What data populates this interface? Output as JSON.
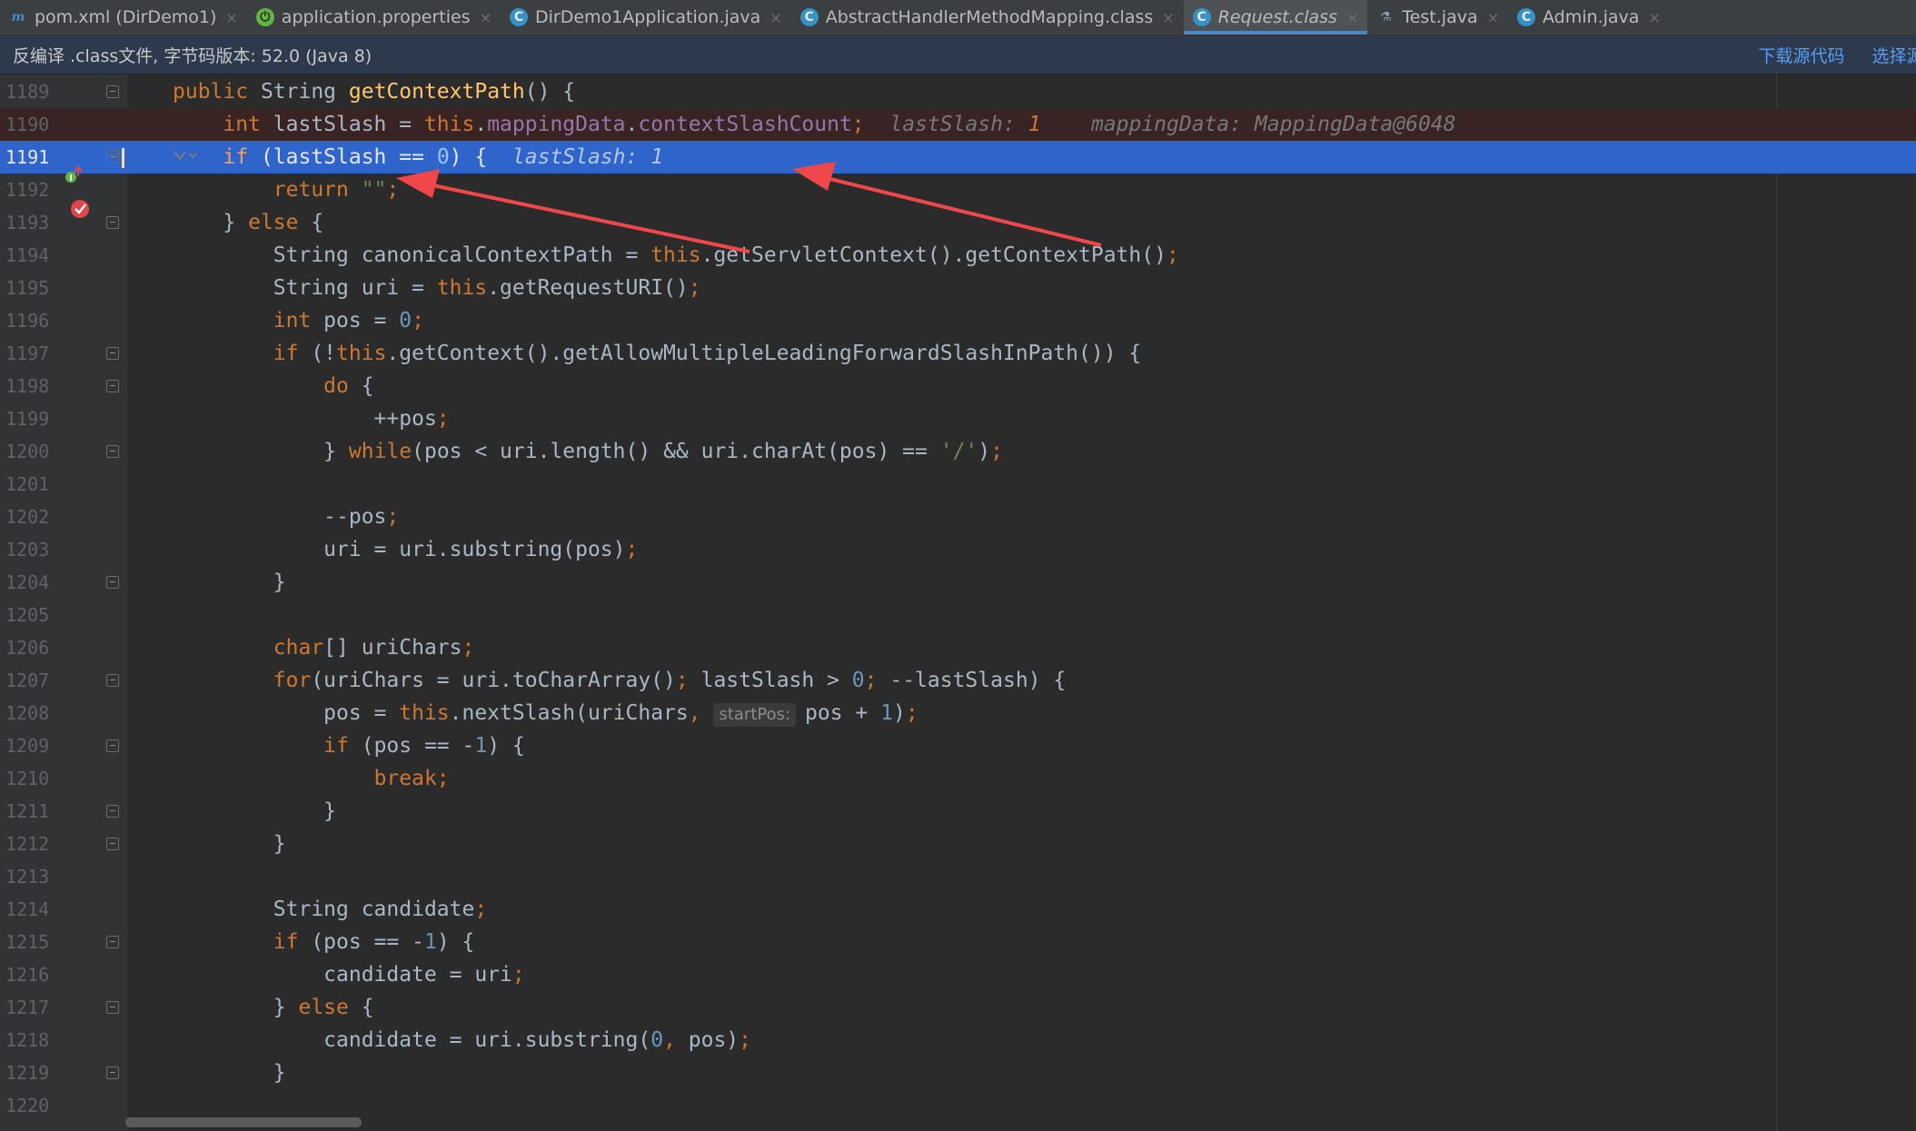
{
  "tabs": [
    {
      "label": "pom.xml (DirDemo1)",
      "icon": "maven-icon",
      "active": false
    },
    {
      "label": "application.properties",
      "icon": "spring-icon",
      "active": false
    },
    {
      "label": "DirDemo1Application.java",
      "icon": "spring-class-icon",
      "active": false
    },
    {
      "label": "AbstractHandlerMethodMapping.class",
      "icon": "class-icon",
      "active": false
    },
    {
      "label": "Request.class",
      "icon": "class-icon",
      "active": true
    },
    {
      "label": "Test.java",
      "icon": "test-icon",
      "active": false
    },
    {
      "label": "Admin.java",
      "icon": "class-icon",
      "active": false
    }
  ],
  "tab_close_glyph": "×",
  "banner": {
    "text": "反编译 .class文件, 字节码版本: 52.0 (Java 8)",
    "download_source": "下载源代码",
    "choose_source": "选择源 ("
  },
  "colors": {
    "accent": "#2f65ca",
    "breakpoint": "#e0474c",
    "arrow": "#f0474a"
  },
  "editor": {
    "current_line": 1191,
    "breakpoint_line": 1190,
    "param_hint_label": "startPos:",
    "lines": [
      {
        "num": "1189",
        "tokens": [
          [
            "t-kw",
            "public "
          ],
          [
            "",
            "String "
          ],
          [
            "t-fn",
            "getContextPath"
          ],
          [
            "",
            "() {"
          ]
        ]
      },
      {
        "num": "1190",
        "tokens": [
          [
            "",
            "    "
          ],
          [
            "t-kw",
            "int "
          ],
          [
            "",
            "lastSlash = "
          ],
          [
            "t-kw",
            "this"
          ],
          [
            "",
            "."
          ],
          [
            "t-fld",
            "mappingData"
          ],
          [
            "",
            "."
          ],
          [
            "t-fld",
            "contextSlashCount"
          ],
          [
            "t-kw",
            ";"
          ],
          [
            "",
            "  "
          ],
          [
            "t-hint",
            "lastSlash: "
          ],
          [
            "t-hintval",
            "1"
          ],
          [
            "",
            "    "
          ],
          [
            "t-hint",
            "mappingData: MappingData@6048"
          ]
        ]
      },
      {
        "num": "1191",
        "tokens": [
          [
            "",
            "    "
          ],
          [
            "t-kw",
            "if "
          ],
          [
            "",
            "(lastSlash == "
          ],
          [
            "t-num",
            "0"
          ],
          [
            "",
            ") {  "
          ],
          [
            "t-hint",
            "lastSlash: 1"
          ]
        ]
      },
      {
        "num": "1192",
        "tokens": [
          [
            "",
            "        "
          ],
          [
            "t-kw",
            "return "
          ],
          [
            "t-str",
            "\"\""
          ],
          [
            "t-kw",
            ";"
          ]
        ]
      },
      {
        "num": "1193",
        "tokens": [
          [
            "",
            "    } "
          ],
          [
            "t-kw",
            "else "
          ],
          [
            "",
            "{"
          ]
        ]
      },
      {
        "num": "1194",
        "tokens": [
          [
            "",
            "        String canonicalContextPath = "
          ],
          [
            "t-kw",
            "this"
          ],
          [
            "",
            ".getServletContext().getContextPath()"
          ],
          [
            "t-kw",
            ";"
          ]
        ]
      },
      {
        "num": "1195",
        "tokens": [
          [
            "",
            "        String uri = "
          ],
          [
            "t-kw",
            "this"
          ],
          [
            "",
            ".getRequestURI()"
          ],
          [
            "t-kw",
            ";"
          ]
        ]
      },
      {
        "num": "1196",
        "tokens": [
          [
            "",
            "        "
          ],
          [
            "t-kw",
            "int "
          ],
          [
            "",
            "pos = "
          ],
          [
            "t-num",
            "0"
          ],
          [
            "t-kw",
            ";"
          ]
        ]
      },
      {
        "num": "1197",
        "tokens": [
          [
            "",
            "        "
          ],
          [
            "t-kw",
            "if "
          ],
          [
            "",
            "(!"
          ],
          [
            "t-kw",
            "this"
          ],
          [
            "",
            ".getContext().getAllowMultipleLeadingForwardSlashInPath()) {"
          ]
        ]
      },
      {
        "num": "1198",
        "tokens": [
          [
            "",
            "            "
          ],
          [
            "t-kw",
            "do "
          ],
          [
            "",
            "{"
          ]
        ]
      },
      {
        "num": "1199",
        "tokens": [
          [
            "",
            "                ++pos"
          ],
          [
            "t-kw",
            ";"
          ]
        ]
      },
      {
        "num": "1200",
        "tokens": [
          [
            "",
            "            } "
          ],
          [
            "t-kw",
            "while"
          ],
          [
            "",
            "(pos < uri.length() && uri.charAt(pos) == "
          ],
          [
            "t-str",
            "'/'"
          ],
          [
            "",
            ")"
          ],
          [
            "t-kw",
            ";"
          ]
        ]
      },
      {
        "num": "1201",
        "tokens": []
      },
      {
        "num": "1202",
        "tokens": [
          [
            "",
            "            --pos"
          ],
          [
            "t-kw",
            ";"
          ]
        ]
      },
      {
        "num": "1203",
        "tokens": [
          [
            "",
            "            uri = uri.substring(pos)"
          ],
          [
            "t-kw",
            ";"
          ]
        ]
      },
      {
        "num": "1204",
        "tokens": [
          [
            "",
            "        }"
          ]
        ]
      },
      {
        "num": "1205",
        "tokens": []
      },
      {
        "num": "1206",
        "tokens": [
          [
            "",
            "        "
          ],
          [
            "t-kw",
            "char"
          ],
          [
            "",
            "[] uriChars"
          ],
          [
            "t-kw",
            ";"
          ]
        ]
      },
      {
        "num": "1207",
        "tokens": [
          [
            "",
            "        "
          ],
          [
            "t-kw",
            "for"
          ],
          [
            "",
            "(uriChars = uri.toCharArray()"
          ],
          [
            "t-kw",
            "; "
          ],
          [
            "",
            "lastSlash > "
          ],
          [
            "t-num",
            "0"
          ],
          [
            "t-kw",
            "; "
          ],
          [
            "",
            "--lastSlash) {"
          ]
        ]
      },
      {
        "num": "1208",
        "tokens": [
          [
            "",
            "            pos = "
          ],
          [
            "t-kw",
            "this"
          ],
          [
            "",
            ".nextSlash(uriChars"
          ],
          [
            "t-kw",
            ", "
          ],
          [
            "t-param",
            "startPos:"
          ],
          [
            "",
            "pos + "
          ],
          [
            "t-num",
            "1"
          ],
          [
            "",
            ")"
          ],
          [
            "t-kw",
            ";"
          ]
        ]
      },
      {
        "num": "1209",
        "tokens": [
          [
            "",
            "            "
          ],
          [
            "t-kw",
            "if "
          ],
          [
            "",
            "(pos == -"
          ],
          [
            "t-num",
            "1"
          ],
          [
            "",
            ") {"
          ]
        ]
      },
      {
        "num": "1210",
        "tokens": [
          [
            "",
            "                "
          ],
          [
            "t-kw",
            "break;"
          ]
        ]
      },
      {
        "num": "1211",
        "tokens": [
          [
            "",
            "            }"
          ]
        ]
      },
      {
        "num": "1212",
        "tokens": [
          [
            "",
            "        }"
          ]
        ]
      },
      {
        "num": "1213",
        "tokens": []
      },
      {
        "num": "1214",
        "tokens": [
          [
            "",
            "        String candidate"
          ],
          [
            "t-kw",
            ";"
          ]
        ]
      },
      {
        "num": "1215",
        "tokens": [
          [
            "",
            "        "
          ],
          [
            "t-kw",
            "if "
          ],
          [
            "",
            "(pos == -"
          ],
          [
            "t-num",
            "1"
          ],
          [
            "",
            ") {"
          ]
        ]
      },
      {
        "num": "1216",
        "tokens": [
          [
            "",
            "            candidate = uri"
          ],
          [
            "t-kw",
            ";"
          ]
        ]
      },
      {
        "num": "1217",
        "tokens": [
          [
            "",
            "        } "
          ],
          [
            "t-kw",
            "else "
          ],
          [
            "",
            "{"
          ]
        ]
      },
      {
        "num": "1218",
        "tokens": [
          [
            "",
            "            candidate = uri.substring("
          ],
          [
            "t-num",
            "0"
          ],
          [
            "t-kw",
            ", "
          ],
          [
            "",
            "pos)"
          ],
          [
            "t-kw",
            ";"
          ]
        ]
      },
      {
        "num": "1219",
        "tokens": [
          [
            "",
            "        }"
          ]
        ]
      },
      {
        "num": "1220",
        "tokens": []
      }
    ]
  }
}
